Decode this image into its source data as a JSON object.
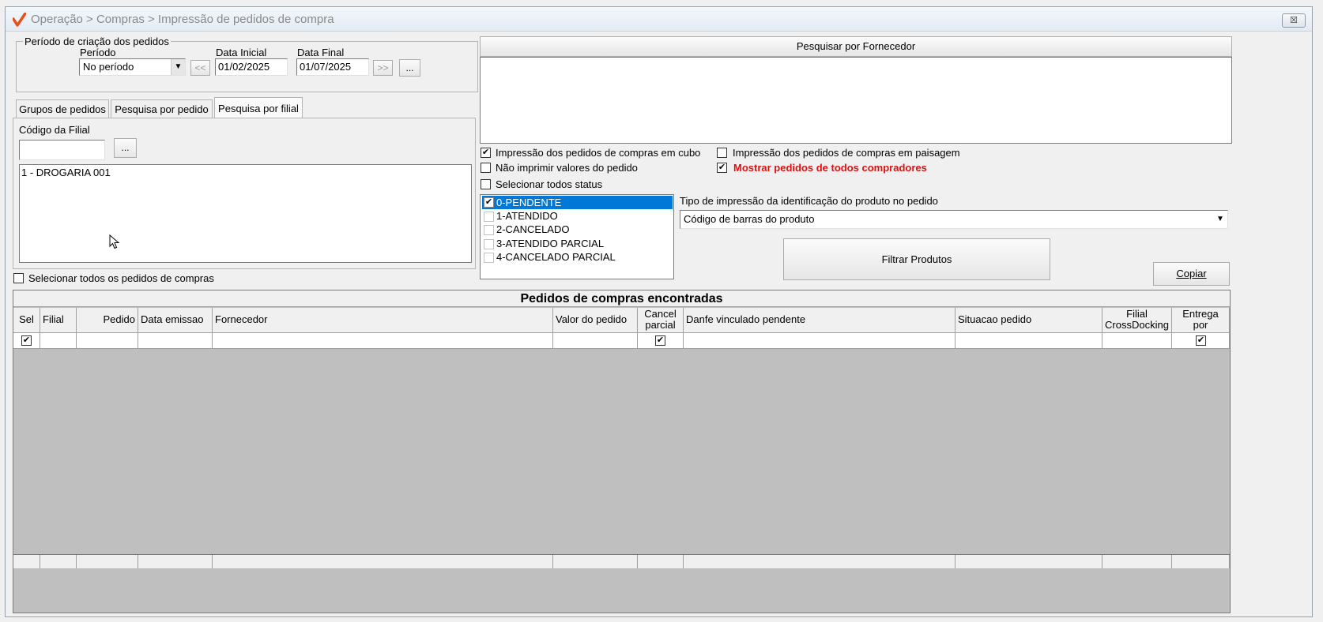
{
  "window": {
    "title": "Operação > Compras > Impressão de pedidos de compra",
    "close_glyph": "☒"
  },
  "periodo_group": {
    "legend": "Período de criação dos pedidos",
    "periodo_label": "Período",
    "periodo_value": "No período",
    "data_inicial_label": "Data Inicial",
    "data_inicial_value": "01/02/2025",
    "data_final_label": "Data Final",
    "data_final_value": "01/07/2025",
    "prev_label": "<<",
    "next_label": ">>",
    "ellipsis_label": "..."
  },
  "tabs": [
    {
      "label": "Grupos de pedidos",
      "active": false
    },
    {
      "label": "Pesquisa por pedido",
      "active": false
    },
    {
      "label": "Pesquisa por filial",
      "active": true
    }
  ],
  "filial": {
    "codigo_label": "Código da Filial",
    "codigo_value": "",
    "lookup_label": "...",
    "list_items": [
      "1 - DROGARIA 001"
    ]
  },
  "selecionar_todos_pedidos": {
    "label": "Selecionar todos os pedidos de compras",
    "checked": false
  },
  "fornecedor": {
    "header": "Pesquisar por Fornecedor"
  },
  "options": {
    "cubo": {
      "label": "Impressão dos pedidos de compras em cubo",
      "checked": true
    },
    "paisagem": {
      "label": "Impressão dos pedidos de compras em paisagem",
      "checked": false
    },
    "nao_imprimir": {
      "label": "Não imprimir valores do pedido",
      "checked": false
    },
    "mostrar_todos": {
      "label": "Mostrar pedidos de todos compradores",
      "checked": true,
      "color": "#e01010"
    },
    "selecionar_status": {
      "label": "Selecionar todos status",
      "checked": false
    }
  },
  "status_list": [
    {
      "label": "0-PENDENTE",
      "checked": true,
      "selected": true
    },
    {
      "label": "1-ATENDIDO",
      "checked": false,
      "selected": false
    },
    {
      "label": "2-CANCELADO",
      "checked": false,
      "selected": false
    },
    {
      "label": "3-ATENDIDO PARCIAL",
      "checked": false,
      "selected": false
    },
    {
      "label": "4-CANCELADO PARCIAL",
      "checked": false,
      "selected": false
    }
  ],
  "tipo_impressao": {
    "label": "Tipo de impressão da identificação do produto no pedido",
    "value": "Código de barras do produto"
  },
  "buttons": {
    "filtrar": "Filtrar Produtos",
    "copiar": "Copiar"
  },
  "grid": {
    "caption": "Pedidos de compras encontradas",
    "columns": [
      {
        "key": "sel",
        "label": "Sel",
        "align": "center"
      },
      {
        "key": "filial",
        "label": "Filial",
        "align": "left"
      },
      {
        "key": "pedido",
        "label": "Pedido",
        "align": "right"
      },
      {
        "key": "data_emissao",
        "label": "Data emissao",
        "align": "left"
      },
      {
        "key": "fornecedor",
        "label": "Fornecedor",
        "align": "left"
      },
      {
        "key": "valor",
        "label": "Valor do pedido",
        "align": "left"
      },
      {
        "key": "cancel_parcial",
        "label": "Cancel\nparcial",
        "align": "center"
      },
      {
        "key": "danfe",
        "label": "Danfe vinculado pendente",
        "align": "left"
      },
      {
        "key": "situacao",
        "label": "Situacao pedido",
        "align": "left"
      },
      {
        "key": "filial_cd",
        "label": "Filial\nCrossDocking",
        "align": "center"
      },
      {
        "key": "entrega_ol",
        "label": "Entrega por\nOL",
        "align": "center"
      }
    ],
    "rows": [
      {
        "sel": true,
        "cancel_parcial": true,
        "entrega_ol": true
      }
    ]
  },
  "colors": {
    "selection": "#0078d7",
    "grid_empty": "#bfbfbf",
    "accent_logo": "#e8501a"
  }
}
